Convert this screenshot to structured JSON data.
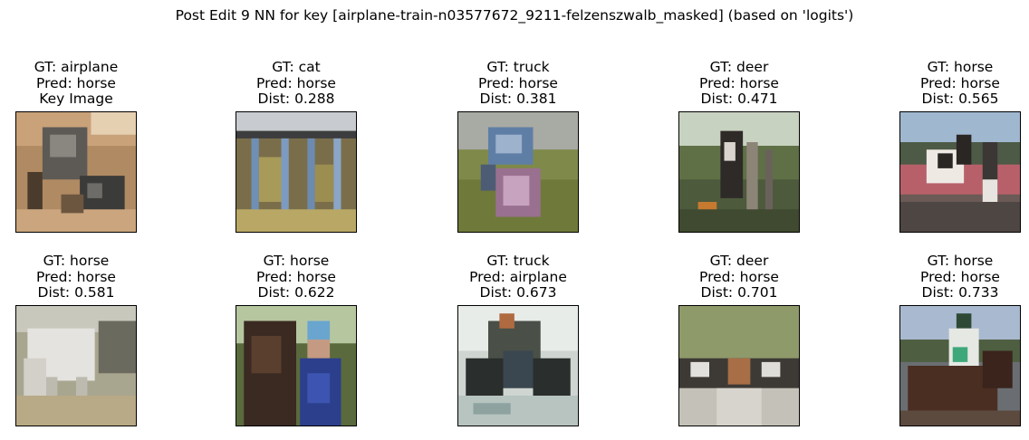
{
  "figure": {
    "title": "Post Edit 9 NN for key [airplane-train-n03577672_9211-felzenszwalb_masked] (based on 'logits')"
  },
  "items": [
    {
      "gt": "GT: airplane",
      "pred": "Pred: horse",
      "extra": "Key Image",
      "image_desc": "dirt-track-carts"
    },
    {
      "gt": "GT: cat",
      "pred": "Pred: horse",
      "extra": "Dist: 0.288",
      "image_desc": "blue-poles-stable"
    },
    {
      "gt": "GT: truck",
      "pred": "Pred: horse",
      "extra": "Dist: 0.381",
      "image_desc": "tractor-field"
    },
    {
      "gt": "GT: deer",
      "pred": "Pred: horse",
      "extra": "Dist: 0.471",
      "image_desc": "horse-by-fence"
    },
    {
      "gt": "GT: horse",
      "pred": "Pred: horse",
      "extra": "Dist: 0.565",
      "image_desc": "pinto-horse-arena"
    },
    {
      "gt": "GT: horse",
      "pred": "Pred: horse",
      "extra": "Dist: 0.581",
      "image_desc": "white-horse-grazing"
    },
    {
      "gt": "GT: horse",
      "pred": "Pred: horse",
      "extra": "Dist: 0.622",
      "image_desc": "horse-with-person"
    },
    {
      "gt": "GT: truck",
      "pred": "Pred: airplane",
      "extra": "Dist: 0.673",
      "image_desc": "tractor-water"
    },
    {
      "gt": "GT: deer",
      "pred": "Pred: horse",
      "extra": "Dist: 0.701",
      "image_desc": "cattle-road"
    },
    {
      "gt": "GT: horse",
      "pred": "Pred: horse",
      "extra": "Dist: 0.733",
      "image_desc": "jockey-racing"
    }
  ]
}
